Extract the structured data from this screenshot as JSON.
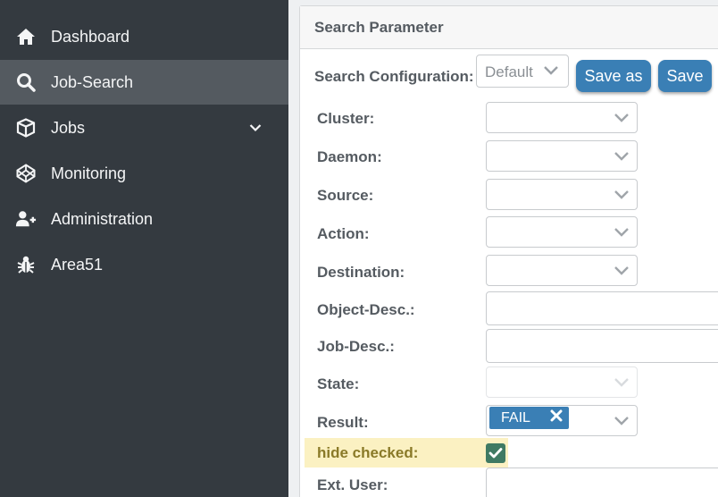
{
  "sidebar": {
    "items": [
      {
        "label": "Dashboard",
        "icon": "home-icon"
      },
      {
        "label": "Job-Search",
        "icon": "search-icon",
        "active": true
      },
      {
        "label": "Jobs",
        "icon": "cube-icon",
        "has_submenu": true
      },
      {
        "label": "Monitoring",
        "icon": "codepen-icon"
      },
      {
        "label": "Administration",
        "icon": "user-plus-icon"
      },
      {
        "label": "Area51",
        "icon": "bug-icon"
      }
    ]
  },
  "panel": {
    "title": "Search Parameter",
    "config_label": "Search Configuration:",
    "config_value": "Default",
    "save_as_label": "Save as",
    "save_label": "Save",
    "fields": {
      "cluster": "Cluster:",
      "daemon": "Daemon:",
      "source": "Source:",
      "action": "Action:",
      "destination": "Destination:",
      "object_desc": "Object-Desc.:",
      "job_desc": "Job-Desc.:",
      "state": "State:",
      "result": "Result:",
      "hide_checked": "hide checked:",
      "ext_user": "Ext. User:"
    },
    "result_tag": "FAIL",
    "hide_checked_value": true
  },
  "colors": {
    "sidebar_bg": "#343a40",
    "sidebar_active": "#545a60",
    "button_blue": "#3a7fb5",
    "highlight_yellow": "#fbf1c2",
    "checkbox_green": "#3f7a63"
  }
}
